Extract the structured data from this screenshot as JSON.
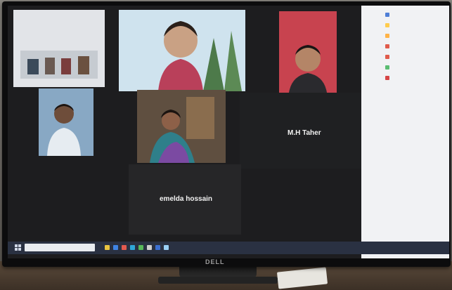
{
  "scene": {
    "brand": "DELL"
  },
  "tiles": [
    {
      "id": "t1",
      "kind": "video",
      "label": ""
    },
    {
      "id": "t2",
      "kind": "video",
      "label": ""
    },
    {
      "id": "t3",
      "kind": "video",
      "label": ""
    },
    {
      "id": "t4",
      "kind": "video",
      "label": ""
    },
    {
      "id": "t5",
      "kind": "video",
      "label": ""
    },
    {
      "id": "t6",
      "kind": "name-card",
      "name": "M.H Taher"
    },
    {
      "id": "t7",
      "kind": "name-card",
      "name": "emelda hossain"
    }
  ],
  "sidebar": {
    "rows": [
      {
        "color": "#4f7fd6",
        "icon": "app-icon"
      },
      {
        "color": "#ffcc4d",
        "icon": "app-icon"
      },
      {
        "color": "#ffb347",
        "icon": "app-icon"
      },
      {
        "color": "#e05b4b",
        "icon": "app-icon"
      },
      {
        "color": "#e05b4b",
        "icon": "app-icon"
      },
      {
        "color": "#5bbd72",
        "icon": "app-icon"
      },
      {
        "color": "#d64545",
        "icon": "app-icon"
      }
    ]
  },
  "taskbar": {
    "start_icon": "windows-start-icon",
    "search_icon": "search-box",
    "apps": [
      {
        "color": "#e9c440",
        "icon": "app-icon"
      },
      {
        "color": "#3f84e5",
        "icon": "app-icon"
      },
      {
        "color": "#e25a4f",
        "icon": "app-icon"
      },
      {
        "color": "#2fa7d8",
        "icon": "app-icon"
      },
      {
        "color": "#58b85a",
        "icon": "app-icon"
      },
      {
        "color": "#cfcfcf",
        "icon": "app-icon"
      },
      {
        "color": "#3b6fd1",
        "icon": "app-icon"
      },
      {
        "color": "#9ad0f5",
        "icon": "app-icon"
      }
    ]
  }
}
